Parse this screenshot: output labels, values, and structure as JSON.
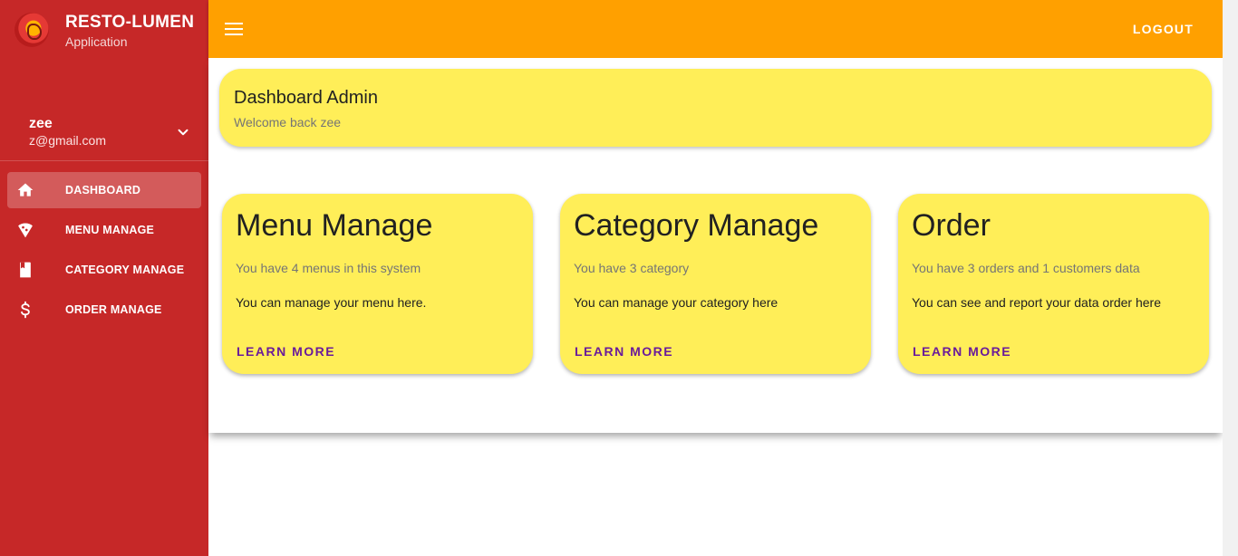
{
  "brand": {
    "title": "RESTO-LUMEN",
    "subtitle": "Application",
    "logo_icon": "restaurant-logo-icon"
  },
  "user": {
    "name": "zee",
    "email": "z@gmail.com",
    "toggle_icon": "chevron-down-icon"
  },
  "sidebar": {
    "items": [
      {
        "label": "DASHBOARD",
        "icon": "home-icon",
        "active": true
      },
      {
        "label": "MENU MANAGE",
        "icon": "pizza-icon",
        "active": false
      },
      {
        "label": "CATEGORY MANAGE",
        "icon": "bookmark-icon",
        "active": false
      },
      {
        "label": "ORDER MANAGE",
        "icon": "dollar-icon",
        "active": false
      }
    ]
  },
  "topbar": {
    "menu_icon": "hamburger-menu-icon",
    "logout_label": "LOGOUT"
  },
  "header": {
    "title": "Dashboard Admin",
    "subtitle": "Welcome back zee"
  },
  "cards": [
    {
      "title": "Menu Manage",
      "subtitle": "You have 4 menus in this system",
      "body": "You can manage your menu here.",
      "action": "LEARN MORE"
    },
    {
      "title": "Category Manage",
      "subtitle": "You have 3 category",
      "body": "You can manage your category here",
      "action": "LEARN MORE"
    },
    {
      "title": "Order",
      "subtitle": "You have 3 orders and 1 customers data",
      "body": "You can see and report your data order here",
      "action": "LEARN MORE"
    }
  ],
  "colors": {
    "sidebar": "#c62828",
    "topbar": "#ffa000",
    "card": "#ffee58",
    "action_text": "#6a1b9a"
  }
}
